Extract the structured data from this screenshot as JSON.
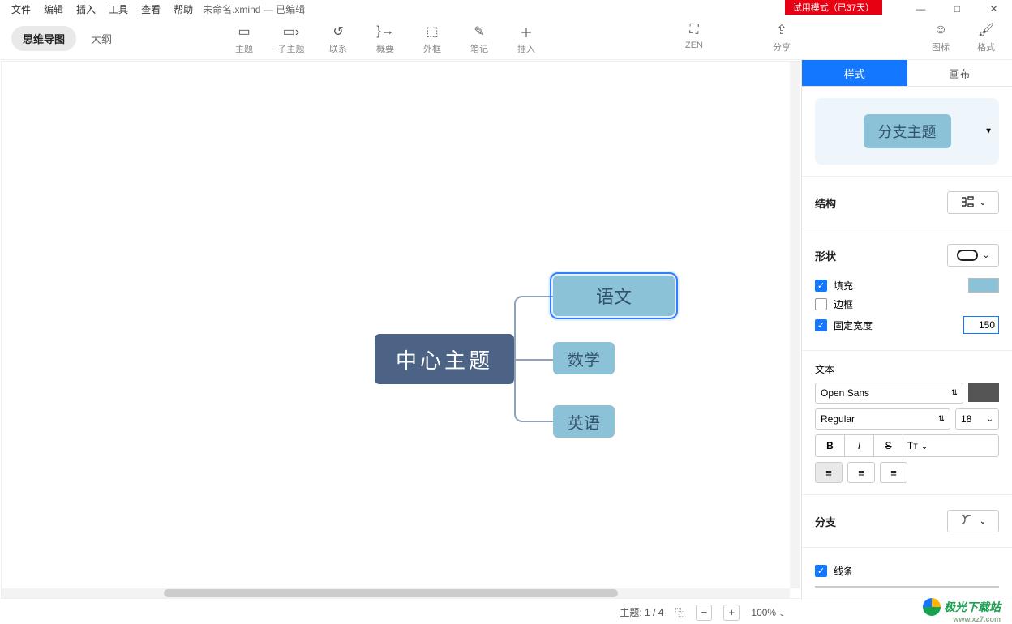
{
  "menu": {
    "file": "文件",
    "edit": "编辑",
    "insert": "插入",
    "tools": "工具",
    "view": "查看",
    "help": "帮助"
  },
  "filename": "未命名.xmind  — 已编辑",
  "trial_badge": "试用模式（已37天）",
  "view_tabs": {
    "mindmap": "思维导图",
    "outline": "大纲"
  },
  "toolbar": {
    "topic": "主题",
    "subtopic": "子主题",
    "relationship": "联系",
    "summary": "概要",
    "boundary": "外框",
    "note": "笔记",
    "insert": "插入",
    "zen": "ZEN",
    "share": "分享",
    "icons": "图标",
    "format": "格式"
  },
  "map": {
    "central": "中心主题",
    "b1": "语文",
    "b2": "数学",
    "b3": "英语"
  },
  "panel": {
    "tab_style": "样式",
    "tab_canvas": "画布",
    "preview_label": "分支主题",
    "structure": "结构",
    "shape": "形状",
    "fill": "填充",
    "border": "边框",
    "fixed_width": "固定宽度",
    "fixed_width_value": "150",
    "text": "文本",
    "font_family": "Open Sans",
    "font_weight": "Regular",
    "font_size": "18",
    "branch": "分支",
    "line": "线条",
    "fill_color": "#8cc2d8",
    "text_color": "#555555"
  },
  "status": {
    "topics": "主题: 1 / 4",
    "zoom": "100%"
  },
  "watermark": {
    "text": "极光下载站",
    "url": "www.xz7.com"
  }
}
